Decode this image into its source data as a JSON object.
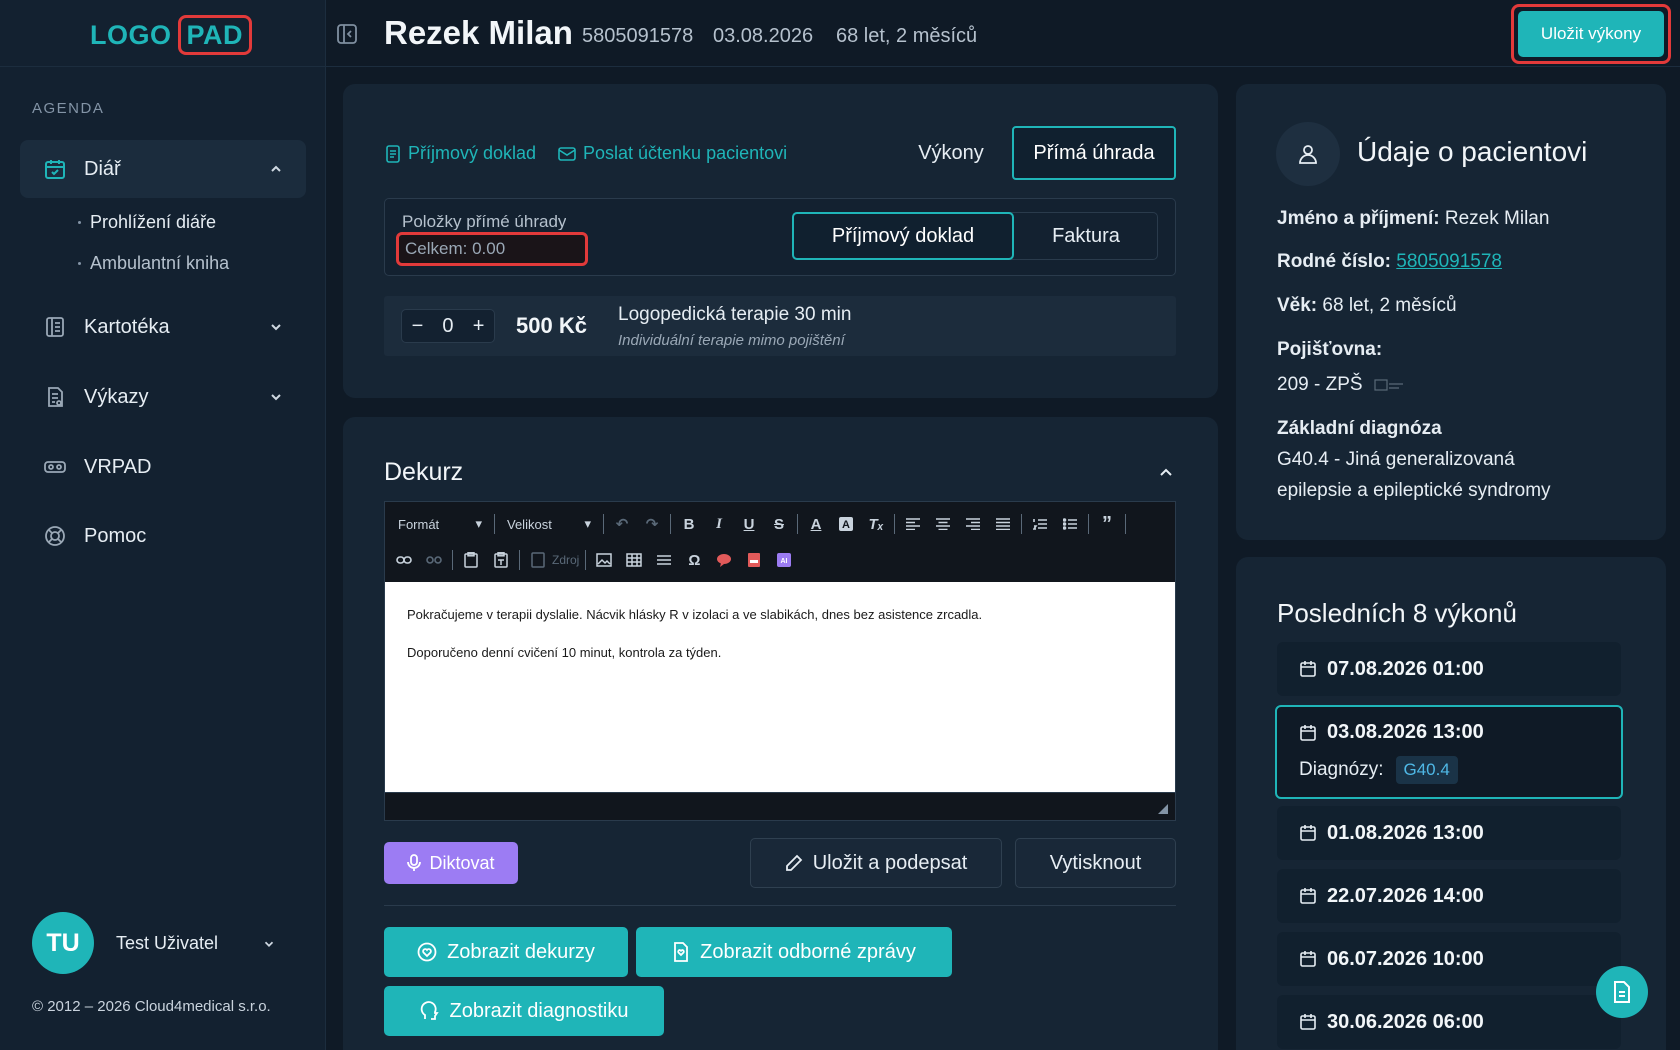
{
  "app": {
    "logo_part1": "LOGO",
    "logo_part2": "PAD",
    "accent_color": "#1fb5b8",
    "highlight_color": "#e23a3a"
  },
  "sidebar": {
    "section_label": "AGENDA",
    "items": [
      {
        "label": "Diář",
        "icon": "calendar-icon",
        "expanded": true
      },
      {
        "label": "Kartotéka",
        "icon": "book-icon"
      },
      {
        "label": "Výkazy",
        "icon": "report-icon"
      },
      {
        "label": "VRPAD",
        "icon": "vr-headset-icon"
      },
      {
        "label": "Pomoc",
        "icon": "lifebuoy-icon"
      }
    ],
    "sub_items": [
      "Prohlížení diáře",
      "Ambulantní kniha"
    ],
    "user": {
      "initials": "TU",
      "name": "Test Uživatel"
    },
    "copyright": "© 2012 – 2026 Cloud4medical s.r.o."
  },
  "header": {
    "patient_name": "Rezek Milan",
    "birth_number": "5805091578",
    "date": "03.08.2026",
    "age": "68 let, 2 měsíců",
    "save_button": "Uložit výkony"
  },
  "payment": {
    "link_receipt": "Příjmový doklad",
    "link_send": "Poslat účtenku pacientovi",
    "tab_services": "Výkony",
    "tab_direct": "Přímá úhrada",
    "items_label": "Položky přímé úhrady",
    "total": "Celkem: 0.00",
    "seg_receipt": "Příjmový doklad",
    "seg_invoice": "Faktura",
    "item": {
      "minus": "−",
      "qty": "0",
      "plus": "+",
      "price": "500 Kč",
      "title": "Logopedická terapie 30 min",
      "subtitle": "Individuální terapie mimo pojištění"
    }
  },
  "dekurz": {
    "title": "Dekurz",
    "toolbar": {
      "format": "Formát",
      "size": "Velikost",
      "source": "Zdroj"
    },
    "text": [
      "Pokračujeme v terapii dyslalie. Nácvik hlásky R v izolaci a ve slabikách, dnes bez asistence zrcadla.",
      "Doporučeno denní cvičení 10 minut, kontrola za týden."
    ],
    "btn_dictate": "Diktovat",
    "btn_save_sign": "Uložit a podepsat",
    "btn_print": "Vytisknout",
    "btn_show_dekurz": "Zobrazit dekurzy",
    "btn_show_reports": "Zobrazit odborné zprávy",
    "btn_show_diag": "Zobrazit diagnostiku"
  },
  "patient": {
    "title": "Údaje o pacientovi",
    "name_label": "Jméno a příjmení:",
    "name_value": "Rezek Milan",
    "rc_label": "Rodné číslo:",
    "rc_value": "5805091578",
    "age_label": "Věk:",
    "age_value": "68 let, 2 měsíců",
    "insurer_label": "Pojišťovna:",
    "insurer_value": "209 - ZPŠ",
    "diag_label": "Základní diagnóza",
    "diag_value_line1": "G40.4 - Jiná generalizovaná",
    "diag_value_line2": "epilepsie a epileptické syndromy"
  },
  "visits": {
    "title": "Posledních 8 výkonů",
    "diag_label": "Diagnózy:",
    "items": [
      {
        "date": "07.08.2026 01:00"
      },
      {
        "date": "03.08.2026 13:00",
        "diag": "G40.4"
      },
      {
        "date": "01.08.2026 13:00"
      },
      {
        "date": "22.07.2026 14:00"
      },
      {
        "date": "06.07.2026 10:00"
      },
      {
        "date": "30.06.2026 06:00"
      }
    ]
  }
}
